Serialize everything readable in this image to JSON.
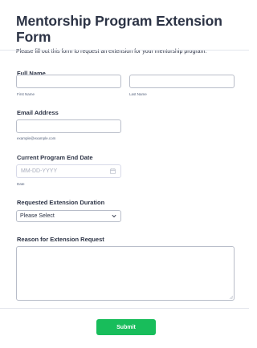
{
  "form": {
    "title": "Mentorship Program Extension Form",
    "subtitle": "Please fill out this form to request an extension for your mentorship program."
  },
  "full_name": {
    "label": "Full Name",
    "first_sublabel": "First Name",
    "last_sublabel": "Last Name",
    "first_value": "",
    "last_value": ""
  },
  "email": {
    "label": "Email Address",
    "sublabel": "example@example.com",
    "value": ""
  },
  "end_date": {
    "label": "Current Program End Date",
    "placeholder": "MM-DD-YYYY",
    "sublabel": "Date",
    "icon": "calendar-icon"
  },
  "extension": {
    "label": "Requested Extension Duration",
    "selected": "Please Select",
    "icon": "chevron-down-icon"
  },
  "reason": {
    "label": "Reason for Extension Request",
    "value": ""
  },
  "submit_label": "Submit",
  "colors": {
    "accent": "#18bd5b",
    "text": "#2c3345",
    "border": "#b8bdc9"
  }
}
